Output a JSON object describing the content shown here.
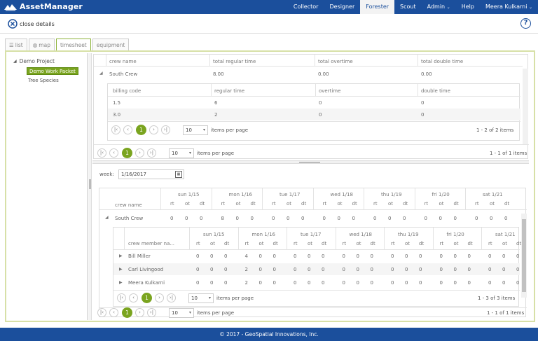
{
  "app": {
    "title": "AssetManager"
  },
  "nav": {
    "items": [
      "Collector",
      "Designer",
      "Forester",
      "Scout",
      "Admin",
      "Help",
      "Meera Kulkarni"
    ],
    "active": "Forester"
  },
  "toolbar": {
    "close_label": "close details",
    "help_label": "?"
  },
  "tabs": [
    {
      "label": "list"
    },
    {
      "label": "map"
    },
    {
      "label": "timesheet",
      "active": true
    },
    {
      "label": "equipment"
    }
  ],
  "tree": {
    "root": "Demo Project",
    "selected": "Demo Work Packet",
    "child": "Tree Species"
  },
  "crew_grid": {
    "headers": [
      "crew name",
      "total regular time",
      "total overtime",
      "total double time"
    ],
    "row": [
      "South Crew",
      "8.00",
      "0.00",
      "0.00"
    ],
    "detail": {
      "headers": [
        "billing code",
        "regular time",
        "overtime",
        "double time"
      ],
      "rows": [
        [
          "1.5",
          "6",
          "0",
          "0"
        ],
        [
          "3.0",
          "2",
          "0",
          "0"
        ]
      ],
      "page": "1",
      "page_size": "10",
      "ipp": "items per page",
      "range": "1 - 2 of 2 items"
    },
    "page": "1",
    "page_size": "10",
    "ipp": "items per page",
    "range": "1 - 1 of 1 items"
  },
  "week": {
    "label": "week:",
    "value": "1/16/2017"
  },
  "week_grid": {
    "crew_label": "crew name",
    "days": [
      "sun  1/15",
      "mon  1/16",
      "tue  1/17",
      "wed  1/18",
      "thu  1/19",
      "fri  1/20",
      "sat  1/21"
    ],
    "subcols": [
      "rt",
      "ot",
      "dt"
    ],
    "row_name": "South Crew",
    "row_values": [
      "0",
      "0",
      "0",
      "8",
      "0",
      "0",
      "0",
      "0",
      "0",
      "0",
      "0",
      "0",
      "0",
      "0",
      "0",
      "0",
      "0",
      "0",
      "0",
      "0",
      "0"
    ],
    "member_label": "crew member na...",
    "members": [
      {
        "name": "Bill Miller",
        "values": [
          "0",
          "0",
          "0",
          "4",
          "0",
          "0",
          "0",
          "0",
          "0",
          "0",
          "0",
          "0",
          "0",
          "0",
          "0",
          "0",
          "0",
          "0",
          "0",
          "0",
          "0"
        ]
      },
      {
        "name": "Carl Livingood",
        "values": [
          "0",
          "0",
          "0",
          "2",
          "0",
          "0",
          "0",
          "0",
          "0",
          "0",
          "0",
          "0",
          "0",
          "0",
          "0",
          "0",
          "0",
          "0",
          "0",
          "0",
          "0"
        ]
      },
      {
        "name": "Meera Kulkarni",
        "values": [
          "0",
          "0",
          "0",
          "2",
          "0",
          "0",
          "0",
          "0",
          "0",
          "0",
          "0",
          "0",
          "0",
          "0",
          "0",
          "0",
          "0",
          "0",
          "0",
          "0",
          "0"
        ]
      }
    ],
    "member_page": "1",
    "member_page_size": "10",
    "member_ipp": "items per page",
    "member_range": "1 - 3 of 3 items",
    "page": "1",
    "page_size": "10",
    "ipp": "items per page",
    "range": "1 - 1 of 1 items"
  },
  "footer": {
    "text": "© 2017 - GeoSpatial Innovations, Inc."
  },
  "colors": {
    "nav": "#1b4f9c",
    "accent": "#7aa41f"
  }
}
